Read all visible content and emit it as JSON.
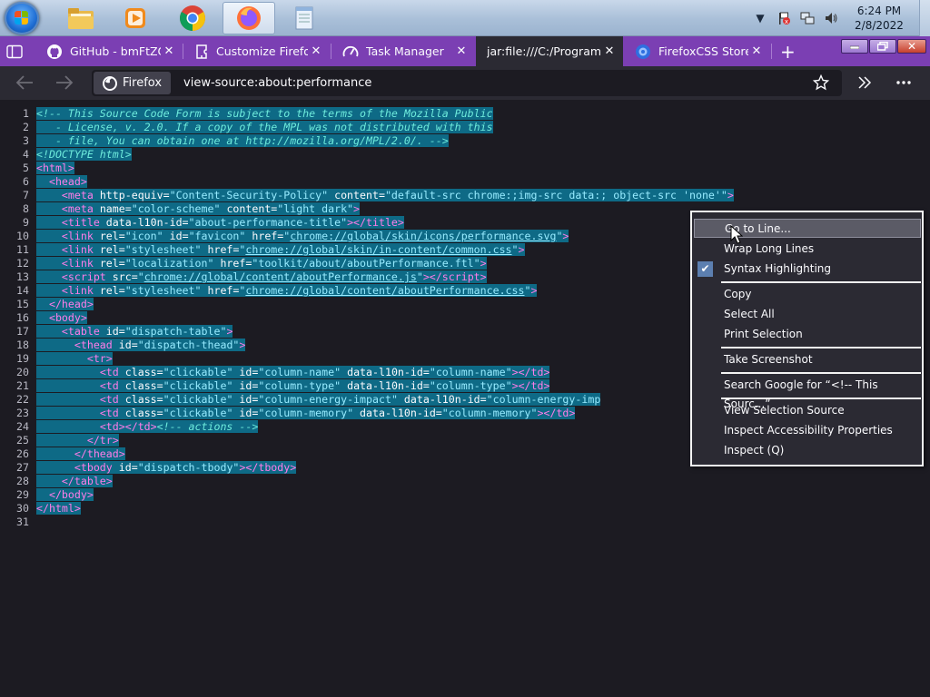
{
  "taskbar": {
    "clock_time": "6:24 PM",
    "clock_date": "2/8/2022",
    "apps": [
      "folder-icon",
      "media-player-icon",
      "chrome-icon",
      "firefox-icon",
      "notepad-icon"
    ]
  },
  "tabs": [
    {
      "label": "GitHub - bmFtZQ/",
      "icon": "github-icon"
    },
    {
      "label": "Customize Firefox",
      "icon": "puzzle-icon"
    },
    {
      "label": "Task Manager",
      "icon": "gauge-icon"
    },
    {
      "label": "jar:file:///C:/Program%",
      "icon": ""
    },
    {
      "label": "FirefoxCSS Store",
      "icon": "store-icon"
    }
  ],
  "navbar": {
    "identity_label": "Firefox",
    "url": "view-source:about:performance"
  },
  "source": {
    "line_numbers": [
      "1",
      "2",
      "3",
      "4",
      "5",
      "6",
      "7",
      "8",
      "9",
      "10",
      "11",
      "12",
      "13",
      "14",
      "15",
      "16",
      "17",
      "18",
      "19",
      "20",
      "21",
      "22",
      "23",
      "24",
      "25",
      "26",
      "27",
      "28",
      "29",
      "30",
      "31"
    ]
  },
  "context_menu": {
    "items": [
      "Go to Line...",
      "Wrap Long Lines",
      "Syntax Highlighting",
      "Copy",
      "Select All",
      "Print Selection",
      "Take Screenshot",
      "Search Google for “<!-- This Sourc...”",
      "View Selection Source",
      "Inspect Accessibility Properties",
      "Inspect (Q)"
    ],
    "checked_item": "Syntax Highlighting"
  },
  "colors": {
    "tabstrip": "#7b3fb3",
    "toolbar": "#2b2a33",
    "content": "#1c1b22",
    "selection": "#0e6a86"
  }
}
